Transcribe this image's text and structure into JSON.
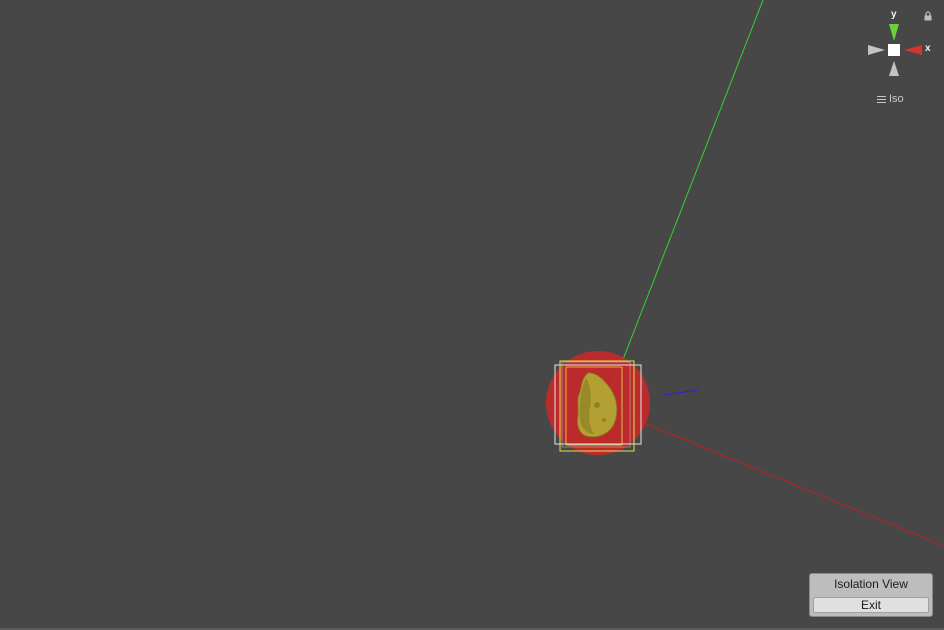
{
  "scene_view": {
    "background_color": "#474747"
  },
  "orientation_gizmo": {
    "y_label": "y",
    "x_label": "x",
    "y_color": "#6ad33a",
    "x_color": "#d8352a",
    "neutral_color": "#c4c4c4",
    "lock_icon": "lock-icon"
  },
  "projection": {
    "icon": "hamburger-icon",
    "label": "Iso"
  },
  "selected_object": {
    "highlight_color": "#c22a2a",
    "bounds_color_yellow": "#e6e052",
    "bounds_color_white": "#e6e6e6",
    "mesh_color": "#b3a032"
  },
  "world_axes": {
    "x_color": "#c21f1f",
    "y_color": "#32d232",
    "z_color": "#2424e0"
  },
  "isolation_panel": {
    "title": "Isolation View",
    "exit_label": "Exit"
  }
}
